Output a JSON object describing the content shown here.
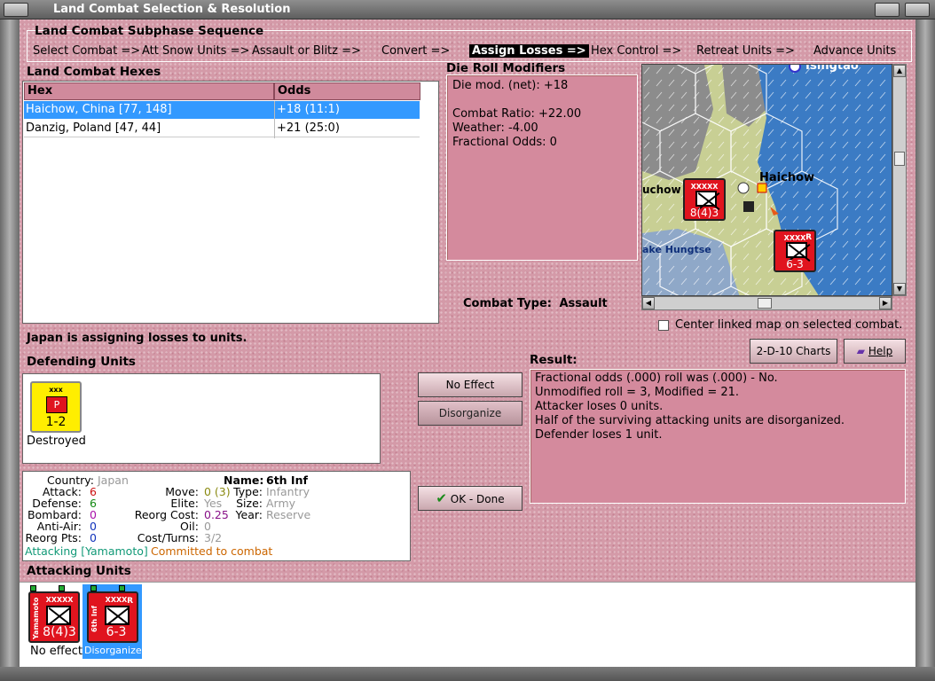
{
  "window": {
    "title": "Land Combat Selection & Resolution"
  },
  "subphase": {
    "label": "Land Combat Subphase Sequence",
    "phases": [
      "Select Combat =>",
      "Att Snow Units =>",
      "Assault or Blitz =>",
      "Convert =>",
      "Assign Losses =>",
      "Hex Control =>",
      "Retreat Units =>",
      "Advance Units"
    ],
    "active_index": 4
  },
  "hexes": {
    "title": "Land Combat Hexes",
    "columns": [
      "Hex",
      "Odds"
    ],
    "rows": [
      {
        "hex": "Haichow, China [77, 148]",
        "odds": "+18 (11:1)"
      },
      {
        "hex": "Danzig, Poland [47, 44]",
        "odds": "+21 (25:0)"
      }
    ],
    "selected_index": 0
  },
  "die_roll": {
    "title": "Die Roll Modifiers",
    "net": "Die mod. (net): +18",
    "combat_ratio": "Combat Ratio: +22.00",
    "weather": "Weather: -4.00",
    "fractional": "Fractional Odds: 0"
  },
  "map": {
    "labels": {
      "top": "Tsingtao",
      "city": "Haichow",
      "left": "uchow",
      "lake": "ake Hungtse"
    },
    "unit_a": {
      "size": "XXXXX",
      "strength": "8(4)3"
    },
    "unit_b": {
      "size": "XXXX",
      "strength": "6-3",
      "tag": "R"
    }
  },
  "combat_type": {
    "label": "Combat Type:",
    "value": "Assault"
  },
  "center_linked": {
    "label": "Center linked map on selected combat.",
    "checked": false
  },
  "buttons": {
    "charts": "2-D-10 Charts",
    "help": "Help",
    "no_effect": "No Effect",
    "disorganize": "Disorganize",
    "ok": "OK - Done"
  },
  "status": "Japan is assigning losses to units.",
  "defending": {
    "title": "Defending Units",
    "units": [
      {
        "size": "xxx",
        "symbol": "P",
        "strength": "1-2",
        "caption": "Destroyed",
        "color": "#ffee00"
      }
    ]
  },
  "info": {
    "country_label": "Country:",
    "country": "Japan",
    "attack_label": "Attack:",
    "attack": "6",
    "defense_label": "Defense:",
    "defense": "6",
    "bombard_label": "Bombard:",
    "bombard": "0",
    "antiair_label": "Anti-Air:",
    "antiair": "0",
    "reorg_label": "Reorg Pts:",
    "reorg": "0",
    "name_label": "Name:",
    "name": "6th Inf",
    "move_label": "Move:",
    "move": "0 (3)",
    "type_label": "Type:",
    "type": "Infantry",
    "elite_label": "Elite:",
    "elite": "Yes",
    "size_label": "Size:",
    "size": "Army",
    "reorg_cost_label": "Reorg Cost:",
    "reorg_cost": "0.25",
    "year_label": "Year:",
    "year": "Reserve",
    "oil_label": "Oil:",
    "oil": "0",
    "cost_label": "Cost/Turns:",
    "cost": "3/2",
    "attacking": "Attacking [Yamamoto]",
    "committed": "Committed to combat"
  },
  "result": {
    "title": "Result:",
    "lines": [
      "Fractional odds (.000) roll was (.000)  - No.",
      "Unmodified roll = 3, Modified = 21.",
      "Attacker loses 0 units.",
      "Half of the surviving attacking units are disorganized.",
      "Defender loses 1 unit."
    ]
  },
  "attacking": {
    "title": "Attacking Units",
    "units": [
      {
        "name": "Yamamoto",
        "size": "XXXXX",
        "strength": "8(4)3",
        "caption": "No effect",
        "tag": ""
      },
      {
        "name": "6th Inf",
        "size": "XXXX",
        "strength": "6-3",
        "caption": "Disorganized",
        "tag": "R"
      }
    ]
  },
  "colors": {
    "unit_red": "#e0141e",
    "selection_blue": "#3399ff",
    "panel_pink": "#d48a9d",
    "defender_yellow": "#ffee00"
  }
}
